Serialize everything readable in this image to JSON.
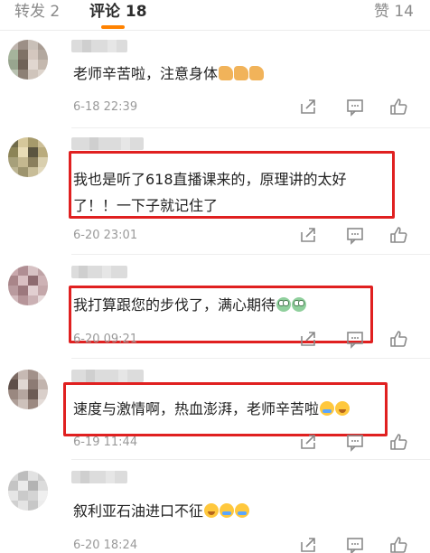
{
  "tabs": {
    "forward": "转发 2",
    "comments": "评论 18",
    "likes": "赞 14"
  },
  "colors": {
    "accent": "#ff8200",
    "highlight": "#e02020"
  },
  "comments": [
    {
      "text": "老师辛苦啦，注意身体",
      "emojis": [
        "thumbs-up",
        "thumbs-up",
        "thumbs-up"
      ],
      "time": "6-18 22:39"
    },
    {
      "line1": "我也是听了618直播课来的，原理讲的太好",
      "line2": "了！！一下子就记住了",
      "time": "6-20 23:01"
    },
    {
      "text": "我打算跟您的步伐了，满心期待",
      "emojis": [
        "frog",
        "frog"
      ],
      "time": "6-20 09:21"
    },
    {
      "text": "速度与激情啊，热血澎湃，老师辛苦啦",
      "emojis": [
        "cry",
        "laugh-cry"
      ],
      "time": "6-19 11:44"
    },
    {
      "text": "叙利亚石油进口不征",
      "emojis": [
        "laugh-cry",
        "cry",
        "cry"
      ],
      "time": "6-20 18:24"
    }
  ],
  "icons": {
    "share": "share-icon",
    "reply": "comment-icon",
    "like": "thumbs-up-icon"
  }
}
